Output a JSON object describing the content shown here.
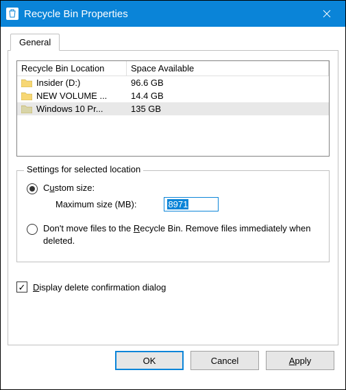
{
  "window": {
    "title": "Recycle Bin Properties"
  },
  "tabs": {
    "general": "General"
  },
  "list": {
    "header_location": "Recycle Bin Location",
    "header_space": "Space Available",
    "rows": [
      {
        "name": "Insider (D:)",
        "space": "96.6 GB",
        "selected": false
      },
      {
        "name": "NEW VOLUME ...",
        "space": "14.4 GB",
        "selected": false
      },
      {
        "name": "Windows 10 Pr...",
        "space": "135 GB",
        "selected": true
      }
    ]
  },
  "settings": {
    "group_label": "Settings for selected location",
    "custom_size_prefix": "C",
    "custom_size_accel": "u",
    "custom_size_suffix": "stom size:",
    "max_size_label": "Maximum size (MB):",
    "max_size_value": "8971",
    "dont_move_prefix": "Don't move files to the ",
    "dont_move_accel": "R",
    "dont_move_suffix": "ecycle Bin. Remove files immediately when deleted.",
    "confirm_prefix": "",
    "confirm_accel": "D",
    "confirm_suffix": "isplay delete confirmation dialog"
  },
  "buttons": {
    "ok": "OK",
    "cancel": "Cancel",
    "apply_accel": "A",
    "apply_suffix": "pply"
  }
}
